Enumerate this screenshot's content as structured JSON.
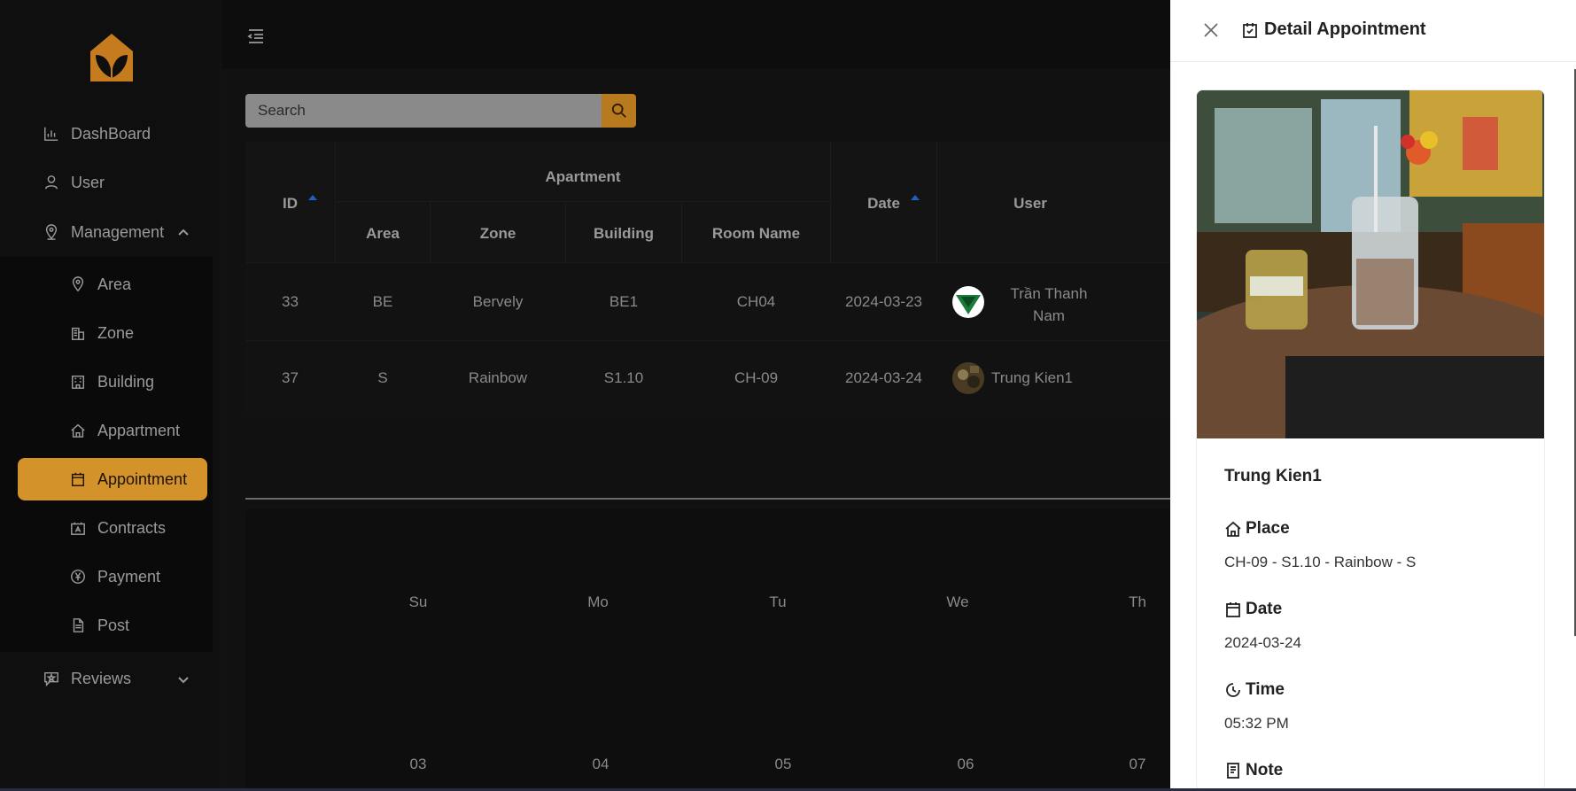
{
  "sidebar": {
    "items": [
      {
        "label": "DashBoard",
        "icon": "bar-chart-icon"
      },
      {
        "label": "User",
        "icon": "user-icon"
      },
      {
        "label": "Management",
        "icon": "location-icon"
      },
      {
        "label": "Area",
        "icon": "map-pin-icon"
      },
      {
        "label": "Zone",
        "icon": "zone-building-icon"
      },
      {
        "label": "Building",
        "icon": "building-icon"
      },
      {
        "label": "Appartment",
        "icon": "home-icon"
      },
      {
        "label": "Appointment",
        "icon": "calendar-icon"
      },
      {
        "label": "Contracts",
        "icon": "contract-icon"
      },
      {
        "label": "Payment",
        "icon": "yen-icon"
      },
      {
        "label": "Post",
        "icon": "document-icon"
      },
      {
        "label": "Reviews",
        "icon": "review-icon"
      }
    ],
    "active": "Appointment",
    "accent": "#d4922a"
  },
  "search": {
    "placeholder": "Search"
  },
  "table": {
    "group_header": "Apartment",
    "headers": {
      "id": "ID",
      "area": "Area",
      "zone": "Zone",
      "building": "Building",
      "room": "Room Name",
      "date": "Date",
      "user": "User"
    },
    "rows": [
      {
        "id": "33",
        "area": "BE",
        "zone": "Bervely",
        "building": "BE1",
        "room": "CH04",
        "date": "2024-03-23",
        "user_line1": "Trần Thanh",
        "user_line2": "Nam"
      },
      {
        "id": "37",
        "area": "S",
        "zone": "Rainbow",
        "building": "S1.10",
        "room": "CH-09",
        "date": "2024-03-24",
        "user_line1": "Trung Kien1",
        "user_line2": ""
      }
    ]
  },
  "calendar": {
    "days": [
      "Su",
      "Mo",
      "Tu",
      "We",
      "Th"
    ],
    "dates": [
      "03",
      "04",
      "05",
      "06",
      "07"
    ]
  },
  "drawer": {
    "title": "Detail Appointment",
    "name": "Trung Kien1",
    "place_label": "Place",
    "place_value": "CH-09 - S1.10 - Rainbow - S",
    "date_label": "Date",
    "date_value": "2024-03-24",
    "time_label": "Time",
    "time_value": "05:32 PM",
    "note_label": "Note"
  }
}
